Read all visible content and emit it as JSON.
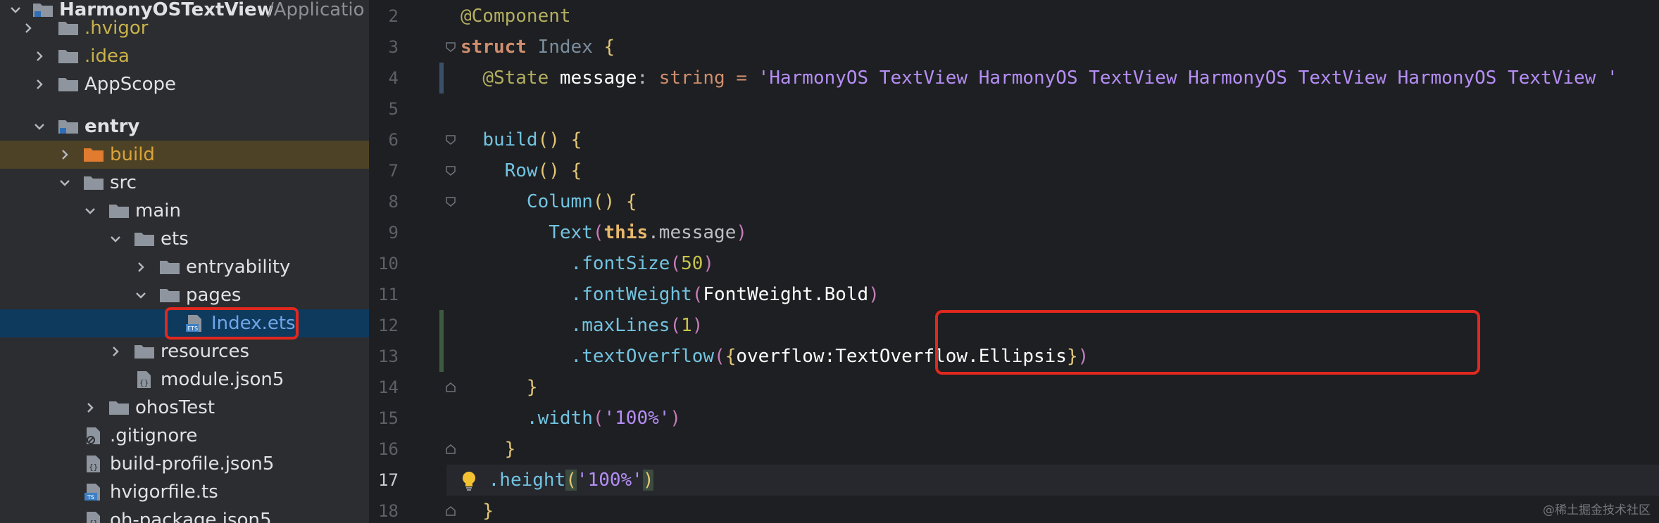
{
  "project_tree": {
    "root": {
      "name": "HarmonyOSTextView",
      "path": "/Applicatio"
    },
    "items": [
      {
        "label": ".hvigor"
      },
      {
        "label": ".idea"
      },
      {
        "label": "AppScope"
      },
      {
        "label": "entry"
      },
      {
        "label": "build"
      },
      {
        "label": "src"
      },
      {
        "label": "main"
      },
      {
        "label": "ets"
      },
      {
        "label": "entryability"
      },
      {
        "label": "pages"
      },
      {
        "label": "Index.ets"
      },
      {
        "label": "resources"
      },
      {
        "label": "module.json5"
      },
      {
        "label": "ohosTest"
      },
      {
        "label": ".gitignore"
      },
      {
        "label": "build-profile.json5"
      },
      {
        "label": "hvigorfile.ts"
      },
      {
        "label": "oh-package.json5"
      }
    ]
  },
  "editor": {
    "line_numbers": [
      "2",
      "3",
      "4",
      "5",
      "6",
      "7",
      "8",
      "9",
      "10",
      "11",
      "12",
      "13",
      "14",
      "15",
      "16",
      "17",
      "18"
    ],
    "current_line": "17",
    "code": {
      "l2_ann": "@Component",
      "l3_kw": "struct",
      "l3_name": "Index",
      "l3_brace": "{",
      "l4_ann": "@State",
      "l4_var": "message",
      "l4_colon": ":",
      "l4_type": "string",
      "l4_eq": "=",
      "l4_str": "'HarmonyOS TextView HarmonyOS TextView HarmonyOS TextView HarmonyOS TextView '",
      "l6_fn": "build",
      "l6_paren": "()",
      "l6_brace": "{",
      "l7_fn": "Row",
      "l7_paren": "()",
      "l7_brace": "{",
      "l8_fn": "Column",
      "l8_paren": "()",
      "l8_brace": "{",
      "l9_fn": "Text",
      "l9_open": "(",
      "l9_this": "this",
      "l9_rest": ".message",
      "l9_close": ")",
      "l10_fn": ".fontSize",
      "l10_open": "(",
      "l10_num": "50",
      "l10_close": ")",
      "l11_fn": ".fontWeight",
      "l11_open": "(",
      "l11_arg": "FontWeight.Bold",
      "l11_close": ")",
      "l12_fn": ".maxLines",
      "l12_open": "(",
      "l12_num": "1",
      "l12_close": ")",
      "l13_fn": ".textOverflow",
      "l13_open": "(",
      "l13_ob": "{",
      "l13_arg": "overflow:TextOverflow.Ellipsis",
      "l13_cb": "}",
      "l13_close": ")",
      "l14_brace": "}",
      "l15_fn": ".width",
      "l15_open": "(",
      "l15_str": "'100%'",
      "l15_close": ")",
      "l16_brace": "}",
      "l17_fn": ".height",
      "l17_open": "(",
      "l17_str": "'100%'",
      "l17_close": ")",
      "l18_brace": "}"
    }
  },
  "watermark": "@稀土掘金技术社区",
  "colors": {
    "highlight_border": "#e0281f",
    "selection": "#0e3a5e",
    "excluded_folder": "#4d4226"
  }
}
